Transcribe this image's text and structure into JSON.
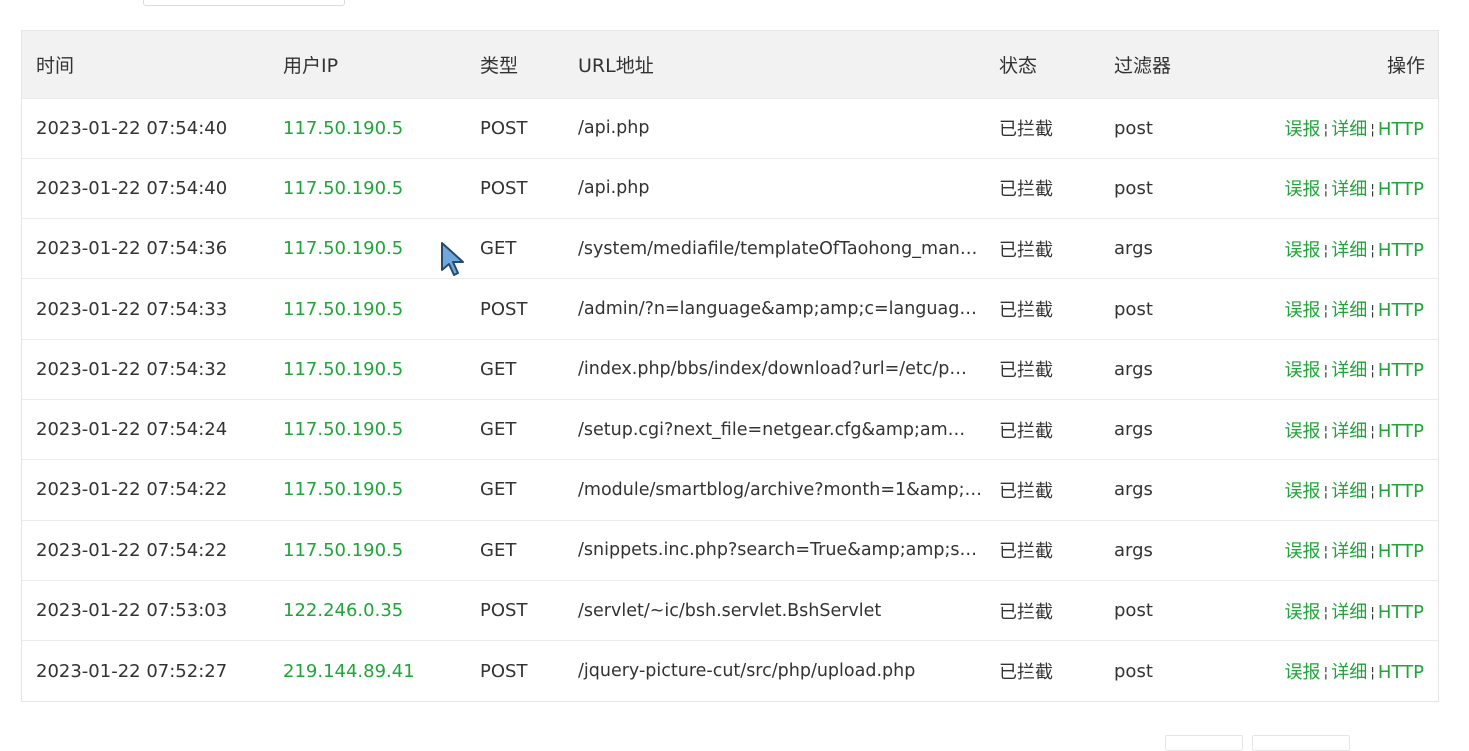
{
  "table": {
    "headers": {
      "time": "时间",
      "ip": "用户IP",
      "type": "类型",
      "url": "URL地址",
      "status": "状态",
      "filter": "过滤器",
      "action": "操作"
    },
    "actions": {
      "report": "误报",
      "detail": "详细",
      "http": "HTTP",
      "separator": "¦"
    },
    "rows": [
      {
        "time": "2023-01-22 07:54:40",
        "ip": "117.50.190.5",
        "type": "POST",
        "url": "/api.php",
        "status": "已拦截",
        "filter": "post"
      },
      {
        "time": "2023-01-22 07:54:40",
        "ip": "117.50.190.5",
        "type": "POST",
        "url": "/api.php",
        "status": "已拦截",
        "filter": "post"
      },
      {
        "time": "2023-01-22 07:54:36",
        "ip": "117.50.190.5",
        "type": "GET",
        "url": "/system/mediafile/templateOfTaohong_man…",
        "status": "已拦截",
        "filter": "args"
      },
      {
        "time": "2023-01-22 07:54:33",
        "ip": "117.50.190.5",
        "type": "POST",
        "url": "/admin/?n=language&amp;amp;c=languag…",
        "status": "已拦截",
        "filter": "post"
      },
      {
        "time": "2023-01-22 07:54:32",
        "ip": "117.50.190.5",
        "type": "GET",
        "url": "/index.php/bbs/index/download?url=/etc/p…",
        "status": "已拦截",
        "filter": "args"
      },
      {
        "time": "2023-01-22 07:54:24",
        "ip": "117.50.190.5",
        "type": "GET",
        "url": "/setup.cgi?next_file=netgear.cfg&amp;am…",
        "status": "已拦截",
        "filter": "args"
      },
      {
        "time": "2023-01-22 07:54:22",
        "ip": "117.50.190.5",
        "type": "GET",
        "url": "/module/smartblog/archive?month=1&amp;…",
        "status": "已拦截",
        "filter": "args"
      },
      {
        "time": "2023-01-22 07:54:22",
        "ip": "117.50.190.5",
        "type": "GET",
        "url": "/snippets.inc.php?search=True&amp;amp;s…",
        "status": "已拦截",
        "filter": "args"
      },
      {
        "time": "2023-01-22 07:53:03",
        "ip": "122.246.0.35",
        "type": "POST",
        "url": "/servlet/~ic/bsh.servlet.BshServlet",
        "status": "已拦截",
        "filter": "post"
      },
      {
        "time": "2023-01-22 07:52:27",
        "ip": "219.144.89.41",
        "type": "POST",
        "url": "/jquery-picture-cut/src/php/upload.php",
        "status": "已拦截",
        "filter": "post"
      }
    ]
  },
  "colors": {
    "accent": "#20a53a",
    "header_bg": "#f2f2f2",
    "border": "#e6e6e6"
  }
}
